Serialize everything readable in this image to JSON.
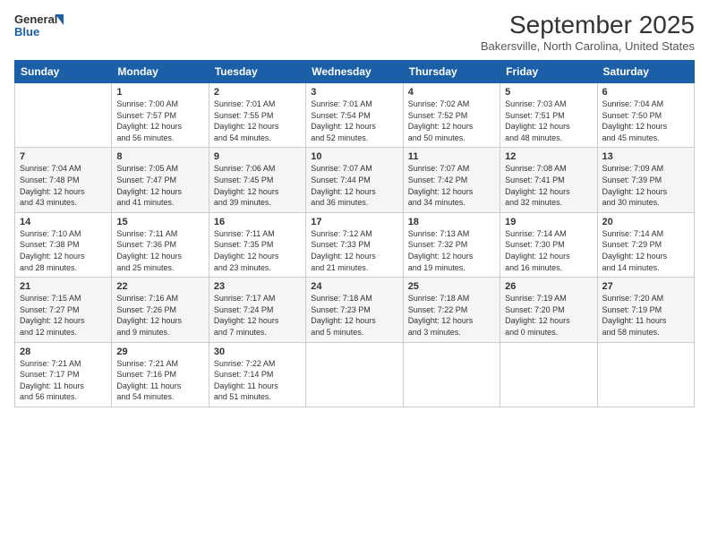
{
  "logo": {
    "general": "General",
    "blue": "Blue"
  },
  "header": {
    "month": "September 2025",
    "location": "Bakersville, North Carolina, United States"
  },
  "days_of_week": [
    "Sunday",
    "Monday",
    "Tuesday",
    "Wednesday",
    "Thursday",
    "Friday",
    "Saturday"
  ],
  "weeks": [
    [
      {
        "day": "",
        "info": ""
      },
      {
        "day": "1",
        "info": "Sunrise: 7:00 AM\nSunset: 7:57 PM\nDaylight: 12 hours\nand 56 minutes."
      },
      {
        "day": "2",
        "info": "Sunrise: 7:01 AM\nSunset: 7:55 PM\nDaylight: 12 hours\nand 54 minutes."
      },
      {
        "day": "3",
        "info": "Sunrise: 7:01 AM\nSunset: 7:54 PM\nDaylight: 12 hours\nand 52 minutes."
      },
      {
        "day": "4",
        "info": "Sunrise: 7:02 AM\nSunset: 7:52 PM\nDaylight: 12 hours\nand 50 minutes."
      },
      {
        "day": "5",
        "info": "Sunrise: 7:03 AM\nSunset: 7:51 PM\nDaylight: 12 hours\nand 48 minutes."
      },
      {
        "day": "6",
        "info": "Sunrise: 7:04 AM\nSunset: 7:50 PM\nDaylight: 12 hours\nand 45 minutes."
      }
    ],
    [
      {
        "day": "7",
        "info": "Sunrise: 7:04 AM\nSunset: 7:48 PM\nDaylight: 12 hours\nand 43 minutes."
      },
      {
        "day": "8",
        "info": "Sunrise: 7:05 AM\nSunset: 7:47 PM\nDaylight: 12 hours\nand 41 minutes."
      },
      {
        "day": "9",
        "info": "Sunrise: 7:06 AM\nSunset: 7:45 PM\nDaylight: 12 hours\nand 39 minutes."
      },
      {
        "day": "10",
        "info": "Sunrise: 7:07 AM\nSunset: 7:44 PM\nDaylight: 12 hours\nand 36 minutes."
      },
      {
        "day": "11",
        "info": "Sunrise: 7:07 AM\nSunset: 7:42 PM\nDaylight: 12 hours\nand 34 minutes."
      },
      {
        "day": "12",
        "info": "Sunrise: 7:08 AM\nSunset: 7:41 PM\nDaylight: 12 hours\nand 32 minutes."
      },
      {
        "day": "13",
        "info": "Sunrise: 7:09 AM\nSunset: 7:39 PM\nDaylight: 12 hours\nand 30 minutes."
      }
    ],
    [
      {
        "day": "14",
        "info": "Sunrise: 7:10 AM\nSunset: 7:38 PM\nDaylight: 12 hours\nand 28 minutes."
      },
      {
        "day": "15",
        "info": "Sunrise: 7:11 AM\nSunset: 7:36 PM\nDaylight: 12 hours\nand 25 minutes."
      },
      {
        "day": "16",
        "info": "Sunrise: 7:11 AM\nSunset: 7:35 PM\nDaylight: 12 hours\nand 23 minutes."
      },
      {
        "day": "17",
        "info": "Sunrise: 7:12 AM\nSunset: 7:33 PM\nDaylight: 12 hours\nand 21 minutes."
      },
      {
        "day": "18",
        "info": "Sunrise: 7:13 AM\nSunset: 7:32 PM\nDaylight: 12 hours\nand 19 minutes."
      },
      {
        "day": "19",
        "info": "Sunrise: 7:14 AM\nSunset: 7:30 PM\nDaylight: 12 hours\nand 16 minutes."
      },
      {
        "day": "20",
        "info": "Sunrise: 7:14 AM\nSunset: 7:29 PM\nDaylight: 12 hours\nand 14 minutes."
      }
    ],
    [
      {
        "day": "21",
        "info": "Sunrise: 7:15 AM\nSunset: 7:27 PM\nDaylight: 12 hours\nand 12 minutes."
      },
      {
        "day": "22",
        "info": "Sunrise: 7:16 AM\nSunset: 7:26 PM\nDaylight: 12 hours\nand 9 minutes."
      },
      {
        "day": "23",
        "info": "Sunrise: 7:17 AM\nSunset: 7:24 PM\nDaylight: 12 hours\nand 7 minutes."
      },
      {
        "day": "24",
        "info": "Sunrise: 7:18 AM\nSunset: 7:23 PM\nDaylight: 12 hours\nand 5 minutes."
      },
      {
        "day": "25",
        "info": "Sunrise: 7:18 AM\nSunset: 7:22 PM\nDaylight: 12 hours\nand 3 minutes."
      },
      {
        "day": "26",
        "info": "Sunrise: 7:19 AM\nSunset: 7:20 PM\nDaylight: 12 hours\nand 0 minutes."
      },
      {
        "day": "27",
        "info": "Sunrise: 7:20 AM\nSunset: 7:19 PM\nDaylight: 11 hours\nand 58 minutes."
      }
    ],
    [
      {
        "day": "28",
        "info": "Sunrise: 7:21 AM\nSunset: 7:17 PM\nDaylight: 11 hours\nand 56 minutes."
      },
      {
        "day": "29",
        "info": "Sunrise: 7:21 AM\nSunset: 7:16 PM\nDaylight: 11 hours\nand 54 minutes."
      },
      {
        "day": "30",
        "info": "Sunrise: 7:22 AM\nSunset: 7:14 PM\nDaylight: 11 hours\nand 51 minutes."
      },
      {
        "day": "",
        "info": ""
      },
      {
        "day": "",
        "info": ""
      },
      {
        "day": "",
        "info": ""
      },
      {
        "day": "",
        "info": ""
      }
    ]
  ]
}
